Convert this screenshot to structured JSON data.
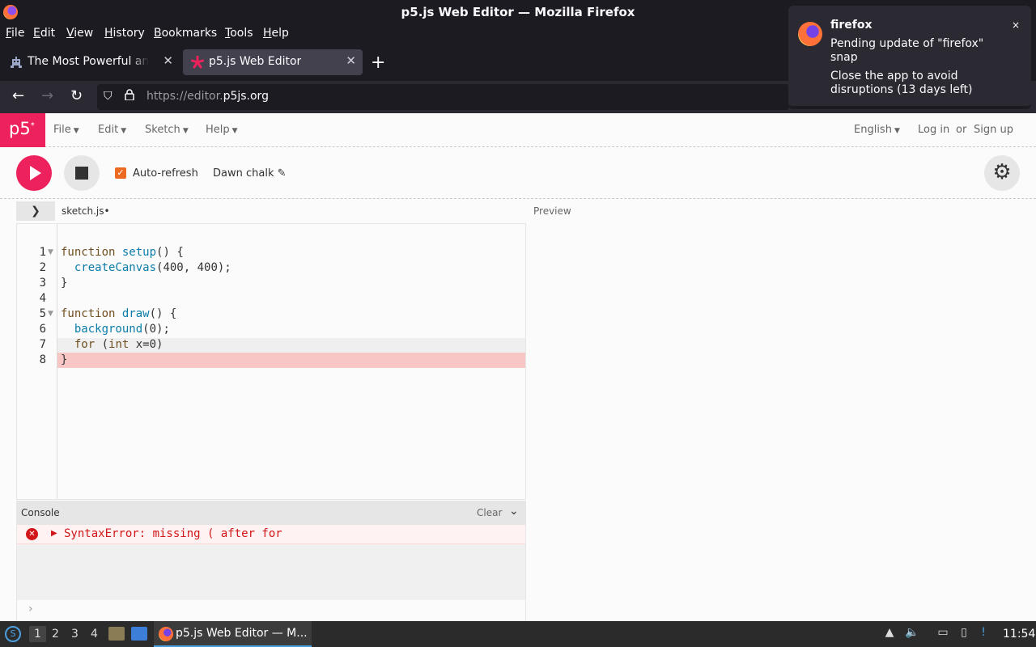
{
  "window": {
    "title": "p5.js Web Editor — Mozilla Firefox"
  },
  "menubar": {
    "items": [
      {
        "label": "File",
        "accel": "F"
      },
      {
        "label": "Edit",
        "accel": "E"
      },
      {
        "label": "View",
        "accel": "V"
      },
      {
        "label": "History",
        "accel": "H"
      },
      {
        "label": "Bookmarks",
        "accel": "B"
      },
      {
        "label": "Tools",
        "accel": "T"
      },
      {
        "label": "Help",
        "accel": "H"
      }
    ]
  },
  "tabs": [
    {
      "label": "The Most Powerful and R",
      "active": false
    },
    {
      "label": "p5.js Web Editor",
      "active": true
    }
  ],
  "urlbar": {
    "prefix": "https://editor.",
    "domain": "p5js.org"
  },
  "notification": {
    "title": "firefox",
    "body": "Pending update of \"firefox\" snap",
    "detail": "Close the app to avoid disruptions (13 days left)",
    "close": "×"
  },
  "p5": {
    "logo": "p5",
    "logo_sup": "*",
    "menu": [
      "File",
      "Edit",
      "Sketch",
      "Help"
    ],
    "language": "English",
    "login": "Log in",
    "or": "or",
    "signup": "Sign up",
    "autorefresh_label": "Auto-refresh",
    "autorefresh_checked": true,
    "sketch_name": "Dawn chalk",
    "file_tab": "sketch.js",
    "unsaved_dot": "•",
    "preview_label": "Preview",
    "accent": "#ed225d"
  },
  "code": {
    "lines": [
      {
        "n": "1",
        "text": "function setup() {"
      },
      {
        "n": "2",
        "text": "  createCanvas(400, 400);"
      },
      {
        "n": "3",
        "text": "}"
      },
      {
        "n": "4",
        "text": ""
      },
      {
        "n": "5",
        "text": "function draw() {"
      },
      {
        "n": "6",
        "text": "  background(0);"
      },
      {
        "n": "7",
        "text": "  for (int x=0)"
      },
      {
        "n": "8",
        "text": "}"
      }
    ]
  },
  "console": {
    "label": "Console",
    "clear": "Clear",
    "error": "SyntaxError: missing ( after for"
  },
  "taskbar": {
    "workspaces": [
      "1",
      "2",
      "3",
      "4"
    ],
    "active_app": "p5.js Web Editor — M...",
    "clock": "11:54"
  }
}
